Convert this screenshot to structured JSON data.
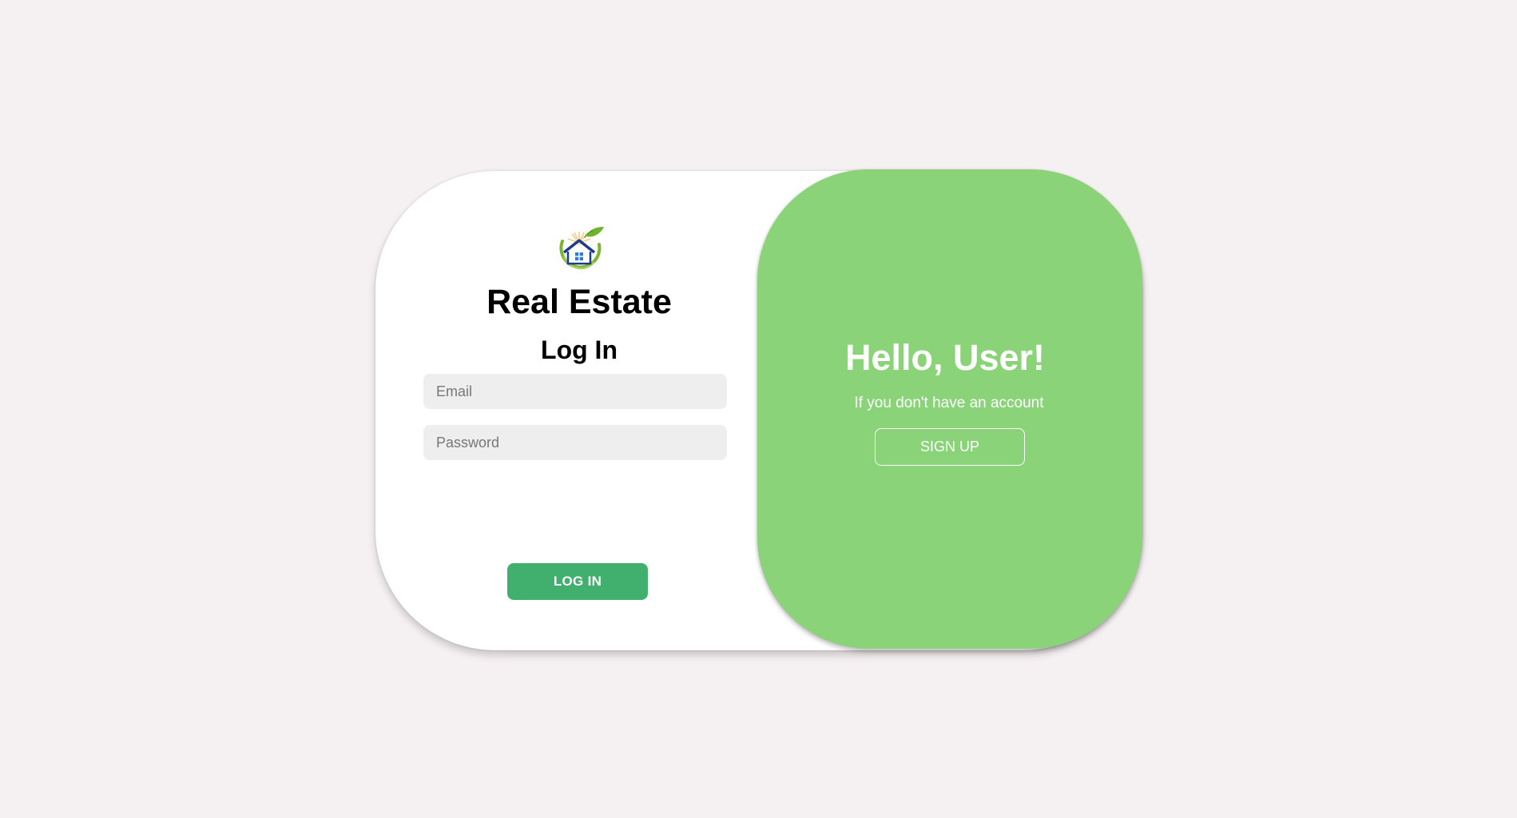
{
  "brand": {
    "logo_icon": "house-sun-leaf-logo-icon",
    "title": "Real Estate"
  },
  "login_form": {
    "title": "Log In",
    "email_placeholder": "Email",
    "email_value": "",
    "password_placeholder": "Password",
    "password_value": "",
    "login_label": "LOG IN"
  },
  "signup_panel": {
    "title": "Hello, User!",
    "subtitle": "If you don't have an account",
    "signup_label": "SIGN UP"
  },
  "colors": {
    "page_background": "#f5f0f1",
    "card_background": "#ffffff",
    "green_panel": "#8ad379",
    "login_button": "#41b06e",
    "input_background": "#eeeeee"
  }
}
